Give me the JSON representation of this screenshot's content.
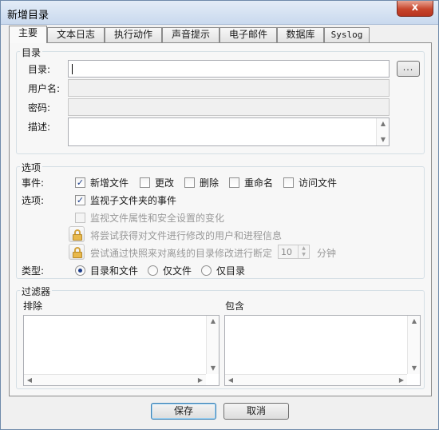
{
  "window": {
    "title": "新增目录",
    "close_label": "x"
  },
  "tabs": [
    "主要",
    "文本日志",
    "执行动作",
    "声音提示",
    "电子邮件",
    "数据库",
    "Syslog"
  ],
  "directory_group": {
    "title": "目录",
    "directory_label": "目录:",
    "directory_value": "",
    "browse_label": "...",
    "username_label": "用户名:",
    "password_label": "密码:",
    "description_label": "描述:"
  },
  "options_group": {
    "title": "选项",
    "events_label": "事件:",
    "events": [
      {
        "label": "新增文件",
        "checked": true
      },
      {
        "label": "更改",
        "checked": false
      },
      {
        "label": "删除",
        "checked": false
      },
      {
        "label": "重命名",
        "checked": false
      },
      {
        "label": "访问文件",
        "checked": false
      }
    ],
    "options_label": "选项:",
    "monitor_subfolders": {
      "label": "监视子文件夹的事件",
      "checked": true
    },
    "monitor_attributes": {
      "label": "监视文件属性和安全设置的变化",
      "checked": false
    },
    "get_user_process": "将尝试获得对文件进行修改的用户和进程信息",
    "snapshot_offline": "尝试通过快照来对离线的目录修改进行断定",
    "snapshot_value": "10",
    "snapshot_unit": "分钟",
    "type_label": "类型:",
    "types": [
      {
        "label": "目录和文件",
        "selected": true
      },
      {
        "label": "仅文件",
        "selected": false
      },
      {
        "label": "仅目录",
        "selected": false
      }
    ]
  },
  "filter_group": {
    "title": "过滤器",
    "exclude_label": "排除",
    "include_label": "包含"
  },
  "footer": {
    "save_label": "保存",
    "cancel_label": "取消"
  },
  "colors": {
    "accent": "#1c3d8a",
    "title_bar": "#c9d9ee",
    "close_button": "#c7452c"
  }
}
